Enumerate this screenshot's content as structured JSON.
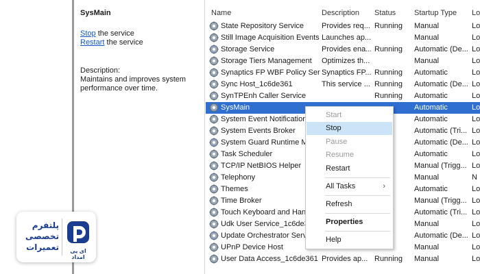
{
  "details": {
    "title": "SysMain",
    "stop_link": "Stop",
    "stop_rest": " the service",
    "restart_link": "Restart",
    "restart_rest": " the service",
    "description_label": "Description:",
    "description_text": "Maintains and improves system performance over time."
  },
  "columns": {
    "name": "Name",
    "description": "Description",
    "status": "Status",
    "startup_type": "Startup Type",
    "log_on": "Lo"
  },
  "rows": [
    {
      "name": "State Repository Service",
      "description": "Provides req...",
      "status": "Running",
      "startup": "Manual",
      "log": "Lo"
    },
    {
      "name": "Still Image Acquisition Events",
      "description": "Launches ap...",
      "status": "",
      "startup": "Manual",
      "log": "Lo"
    },
    {
      "name": "Storage Service",
      "description": "Provides ena...",
      "status": "Running",
      "startup": "Automatic (De...",
      "log": "Lo"
    },
    {
      "name": "Storage Tiers Management",
      "description": "Optimizes th...",
      "status": "",
      "startup": "Manual",
      "log": "Lo"
    },
    {
      "name": "Synaptics FP WBF Policy Ser...",
      "description": "Synaptics FP...",
      "status": "Running",
      "startup": "Automatic",
      "log": "Lo"
    },
    {
      "name": "Sync Host_1c6de361",
      "description": "This service ...",
      "status": "Running",
      "startup": "Automatic (De...",
      "log": "Lo"
    },
    {
      "name": "SynTPEnh Caller Service",
      "description": "",
      "status": "Running",
      "startup": "Automatic",
      "log": "Lo"
    },
    {
      "name": "SysMain",
      "description": "",
      "status": "",
      "startup": "Automatic",
      "log": "Lo"
    },
    {
      "name": "System Event Notification",
      "description": "",
      "status": "",
      "startup": "Automatic",
      "log": "Lo"
    },
    {
      "name": "System Events Broker",
      "description": "",
      "status": "",
      "startup": "Automatic (Tri...",
      "log": "Lo"
    },
    {
      "name": "System Guard Runtime Mo",
      "description": "",
      "status": "",
      "startup": "Automatic (De...",
      "log": "Lo"
    },
    {
      "name": "Task Scheduler",
      "description": "",
      "status": "",
      "startup": "Automatic",
      "log": "Lo"
    },
    {
      "name": "TCP/IP NetBIOS Helper",
      "description": "",
      "status": "",
      "startup": "Manual (Trigg...",
      "log": "Lo"
    },
    {
      "name": "Telephony",
      "description": "",
      "status": "",
      "startup": "Manual",
      "log": "N"
    },
    {
      "name": "Themes",
      "description": "",
      "status": "",
      "startup": "Automatic",
      "log": "Lo"
    },
    {
      "name": "Time Broker",
      "description": "",
      "status": "",
      "startup": "Manual (Trigg...",
      "log": "Lo"
    },
    {
      "name": "Touch Keyboard and Hand",
      "description": "",
      "status": "",
      "startup": "Automatic (Tri...",
      "log": "Lo"
    },
    {
      "name": "Udk User Service_1c6de36",
      "description": "",
      "status": "",
      "startup": "Manual",
      "log": "Lo"
    },
    {
      "name": "Update Orchestrator Servi",
      "description": "",
      "status": "",
      "startup": "Automatic (De...",
      "log": "Lo"
    },
    {
      "name": "UPnP Device Host",
      "description": "",
      "status": "",
      "startup": "Manual",
      "log": "Lo"
    },
    {
      "name": "User Data Access_1c6de361",
      "description": "Provides ap...",
      "status": "Running",
      "startup": "Manual",
      "log": "Lo"
    }
  ],
  "menu": {
    "start": "Start",
    "stop": "Stop",
    "pause": "Pause",
    "resume": "Resume",
    "restart": "Restart",
    "all_tasks": "All Tasks",
    "refresh": "Refresh",
    "properties": "Properties",
    "help": "Help"
  },
  "logo": {
    "line1": "پلتفرم",
    "line2": "تخصصی",
    "line3": "تعمیرات",
    "brand": "ای پی امداد"
  },
  "colors": {
    "selection": "#2f6fd0",
    "menu_highlight": "#cce4f7",
    "link": "#1155cc",
    "logo_blue": "#1a3d8f"
  }
}
